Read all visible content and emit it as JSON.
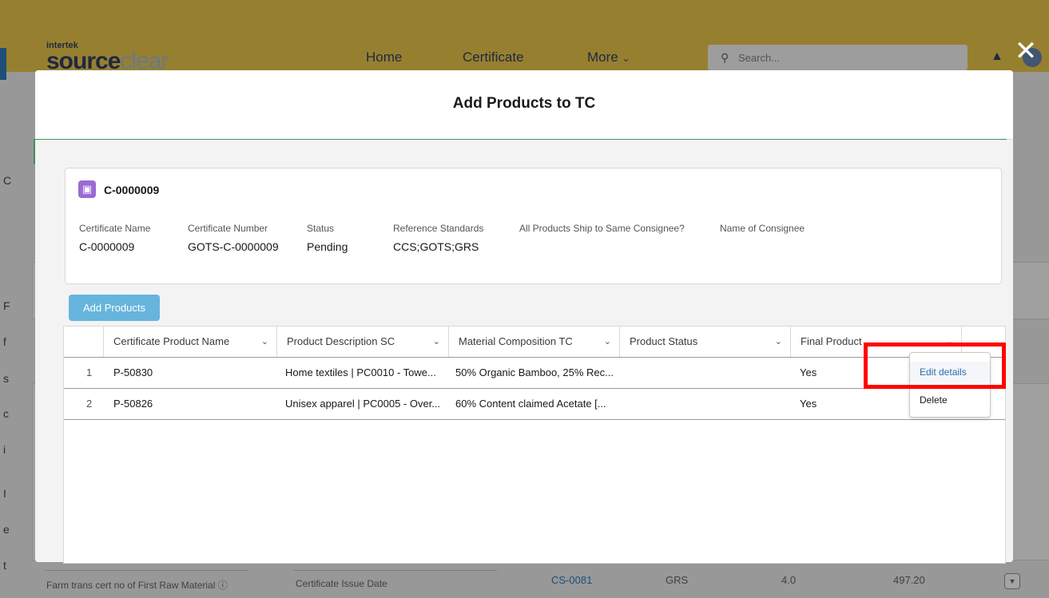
{
  "app": {
    "logo_small": "intertek",
    "logo_main": "source",
    "logo_light": "clear",
    "nav": {
      "home": "Home",
      "certificate": "Certificate",
      "more": "More"
    },
    "search_placeholder": "Search...",
    "search_icon": "search-icon",
    "bell_icon": "bell-icon",
    "avatar_icon": "avatar-icon"
  },
  "background": {
    "left_letters": [
      "C",
      "F",
      "f",
      "s",
      "c",
      "i",
      "I",
      "e",
      "t"
    ],
    "footer": {
      "farm_label": "Farm trans cert no of First Raw Material",
      "issue_label": "Certificate Issue Date",
      "row_id": "CS-0081",
      "row_std": "GRS",
      "row_ver": "4.0",
      "row_amount": "497.20"
    }
  },
  "modal": {
    "title": "Add Products to TC",
    "close_icon": "close-icon",
    "record": {
      "icon": "certificate-record-icon",
      "title": "C-0000009",
      "fields": [
        {
          "label": "Certificate Name",
          "value": "C-0000009"
        },
        {
          "label": "Certificate Number",
          "value": "GOTS-C-0000009"
        },
        {
          "label": "Status",
          "value": "Pending"
        },
        {
          "label": "Reference Standards",
          "value": "CCS;GOTS;GRS"
        },
        {
          "label": "All Products Ship to Same Consignee?",
          "value": ""
        },
        {
          "label": "Name of Consignee",
          "value": ""
        }
      ]
    },
    "add_products_label": "Add Products",
    "table": {
      "columns": [
        "Certificate Product Name",
        "Product Description SC",
        "Material Composition TC",
        "Product Status",
        "Final Product"
      ],
      "rows": [
        {
          "num": "1",
          "name": "P-50830",
          "description": "Home textiles | PC0010 - Towe...",
          "material": "50% Organic Bamboo, 25% Rec...",
          "status": "",
          "final": "Yes"
        },
        {
          "num": "2",
          "name": "P-50826",
          "description": "Unisex apparel | PC0005 - Over...",
          "material": "60% Content claimed Acetate [...",
          "status": "",
          "final": "Yes"
        }
      ]
    },
    "row_menu": {
      "edit": "Edit details",
      "delete": "Delete"
    }
  },
  "colors": {
    "header": "#e8c33a",
    "brand_navy": "#1c2c57",
    "button": "#67b5dd",
    "link": "#2b6eb0",
    "highlight": "#ff0000"
  }
}
